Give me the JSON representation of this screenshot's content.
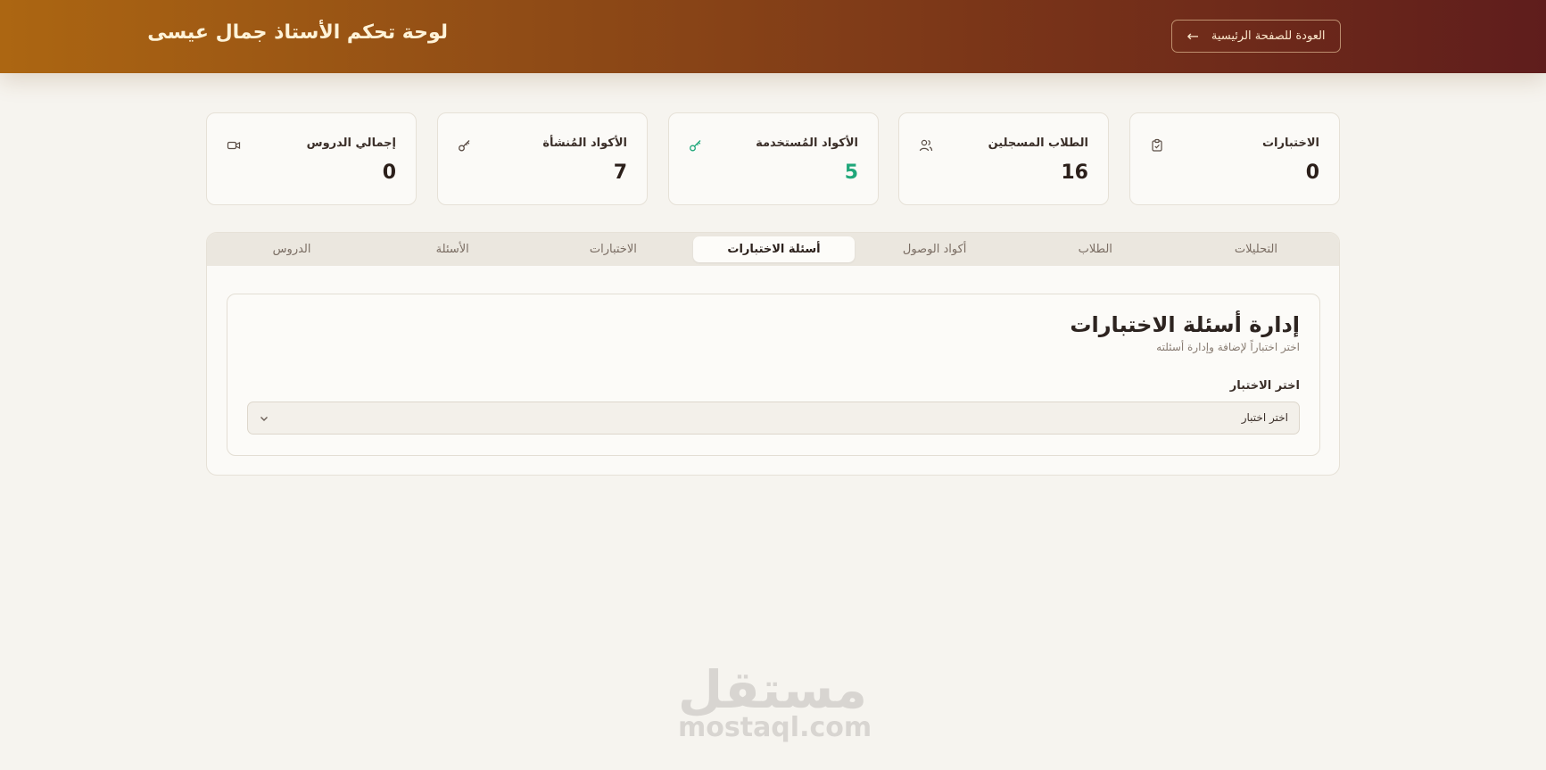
{
  "header": {
    "title": "لوحة تحكم الأستاذ جمال عيسى",
    "back_label": "العودة للصفحة الرئيسية",
    "back_icon": "arrow-left-icon"
  },
  "stats": [
    {
      "label": "الاختبارات",
      "value": "0",
      "icon": "clipboard-check-icon"
    },
    {
      "label": "الطلاب المسجلين",
      "value": "16",
      "icon": "users-icon"
    },
    {
      "label": "الأكواد المُستخدمة",
      "value": "5",
      "icon": "key-icon",
      "color": "#20a77a"
    },
    {
      "label": "الأكواد المُنشأة",
      "value": "7",
      "icon": "key-icon"
    },
    {
      "label": "إجمالي الدروس",
      "value": "0",
      "icon": "video-icon"
    }
  ],
  "tabs": [
    {
      "label": "التحليلات"
    },
    {
      "label": "الطلاب"
    },
    {
      "label": "أكواد الوصول"
    },
    {
      "label": "أسئلة الاختبارات",
      "active": true
    },
    {
      "label": "الاختبارات"
    },
    {
      "label": "الأسئلة"
    },
    {
      "label": "الدروس"
    }
  ],
  "quiz_questions": {
    "title": "إدارة أسئلة الاختبارات",
    "subtitle": "اختر اختباراً لإضافة وإدارة أسئلته",
    "select_label": "اختر الاختبار",
    "select_value": "اختر اختبار"
  },
  "watermark": {
    "arabic": "مستقل",
    "latin": "mostaql.com"
  },
  "colors": {
    "header_start": "#ac6612",
    "header_end": "#5f1d1c",
    "accent_green": "#20a77a",
    "background": "#f6f4ef"
  }
}
